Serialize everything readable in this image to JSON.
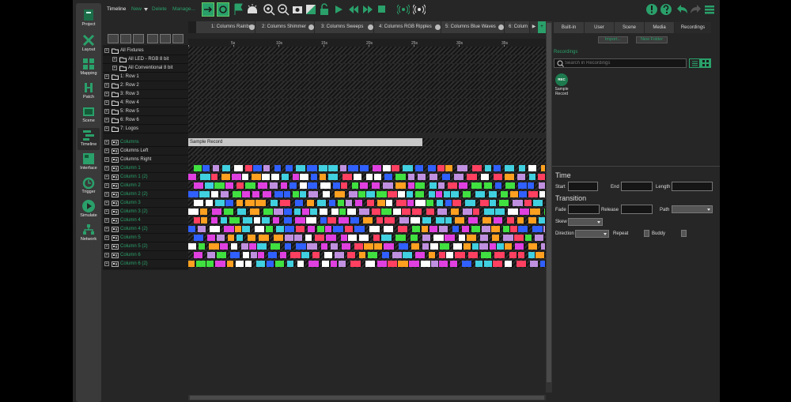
{
  "nav": [
    {
      "label": "Project",
      "icon": "project-icon"
    },
    {
      "label": "Layout",
      "icon": "layout-icon"
    },
    {
      "label": "Mapping",
      "icon": "mapping-icon"
    },
    {
      "label": "Patch",
      "icon": "patch-icon"
    },
    {
      "label": "Scene",
      "icon": "scene-icon"
    },
    {
      "label": "Timeline",
      "icon": "timeline-icon"
    },
    {
      "label": "Interface",
      "icon": "interface-icon"
    },
    {
      "label": "Trigger",
      "icon": "trigger-icon"
    },
    {
      "label": "Simulate",
      "icon": "simulate-icon"
    },
    {
      "label": "Network",
      "icon": "network-icon"
    }
  ],
  "toolbar": {
    "title": "Timeline",
    "new_label": "New",
    "delete_label": "Delete",
    "manage_label": "Manage..."
  },
  "tabs": [
    "1: Columns Rainbow",
    "2: Columns Shimmer",
    "3: Columns Sweeps",
    "4: Columns RGB Ripples",
    "5: Columns Blue Waves",
    "6: Colum"
  ],
  "ruler": [
    "5s",
    "10s",
    "15s",
    "20s",
    "25s",
    "30s",
    "35s"
  ],
  "tree": [
    {
      "label": "All Fixtures",
      "indent": 0,
      "icon": "folder",
      "green": false
    },
    {
      "label": "All LED - RGB 8 bit",
      "indent": 1,
      "icon": "folder",
      "green": false
    },
    {
      "label": "All Conventional 8 bit",
      "indent": 1,
      "icon": "folder",
      "green": false
    },
    {
      "label": "1: Row 1",
      "indent": 0,
      "icon": "folder",
      "green": false
    },
    {
      "label": "2: Row 2",
      "indent": 0,
      "icon": "folder",
      "green": false
    },
    {
      "label": "3: Row 3",
      "indent": 0,
      "icon": "folder",
      "green": false
    },
    {
      "label": "4: Row 4",
      "indent": 0,
      "icon": "folder",
      "green": false
    },
    {
      "label": "5: Row 5",
      "indent": 0,
      "icon": "folder",
      "green": false
    },
    {
      "label": "6: Row 6",
      "indent": 0,
      "icon": "folder",
      "green": false
    },
    {
      "label": "7: Logos",
      "indent": 0,
      "icon": "folder",
      "green": false
    },
    {
      "label": "Columns",
      "indent": 0,
      "icon": "group",
      "green": true
    },
    {
      "label": "Columns Left",
      "indent": 0,
      "icon": "group",
      "green": false
    },
    {
      "label": "Columns Right",
      "indent": 0,
      "icon": "group",
      "green": false
    },
    {
      "label": "Column 1",
      "indent": 0,
      "icon": "group",
      "green": true
    },
    {
      "label": "Column 1 (2)",
      "indent": 0,
      "icon": "group",
      "green": true
    },
    {
      "label": "Column 2",
      "indent": 0,
      "icon": "group",
      "green": true
    },
    {
      "label": "Column 2 (2)",
      "indent": 0,
      "icon": "group",
      "green": true
    },
    {
      "label": "Column 3",
      "indent": 0,
      "icon": "group",
      "green": true
    },
    {
      "label": "Column 3 (2)",
      "indent": 0,
      "icon": "group",
      "green": true
    },
    {
      "label": "Column 4",
      "indent": 0,
      "icon": "group",
      "green": true
    },
    {
      "label": "Column 4 (2)",
      "indent": 0,
      "icon": "group",
      "green": true
    },
    {
      "label": "Column 5",
      "indent": 0,
      "icon": "group",
      "green": true
    },
    {
      "label": "Column 5 (2)",
      "indent": 0,
      "icon": "group",
      "green": true
    },
    {
      "label": "Column 6",
      "indent": 0,
      "icon": "group",
      "green": true
    },
    {
      "label": "Column 6 (2)",
      "indent": 0,
      "icon": "group",
      "green": true
    }
  ],
  "sample_record_label": "Sample Record",
  "block_colors": [
    "#ffffff",
    "#e040e0",
    "#40d0e0",
    "#3060ff",
    "#40e040",
    "#ff4060",
    "#ffa020",
    "#c090e0"
  ],
  "right_panel": {
    "tabs": [
      "Built-in",
      "User",
      "Scene",
      "Media",
      "Recordings"
    ],
    "active_tab": "Recordings",
    "import_label": "Import...",
    "new_folder_label": "New Folder",
    "section_label": "Recordings",
    "search_placeholder": "Search in Recordings",
    "rec_badge": "REC",
    "rec_name": "Sample Record",
    "time_header": "Time",
    "start_label": "Start",
    "end_label": "End",
    "length_label": "Length",
    "transition_header": "Transition",
    "fade_label": "Fade",
    "release_label": "Release",
    "path_label": "Path",
    "skew_label": "Skew",
    "direction_label": "Direction",
    "repeat_label": "Repeat",
    "buddy_label": "Buddy"
  },
  "colors": {
    "accent": "#2aa06a",
    "panel": "#262626"
  }
}
